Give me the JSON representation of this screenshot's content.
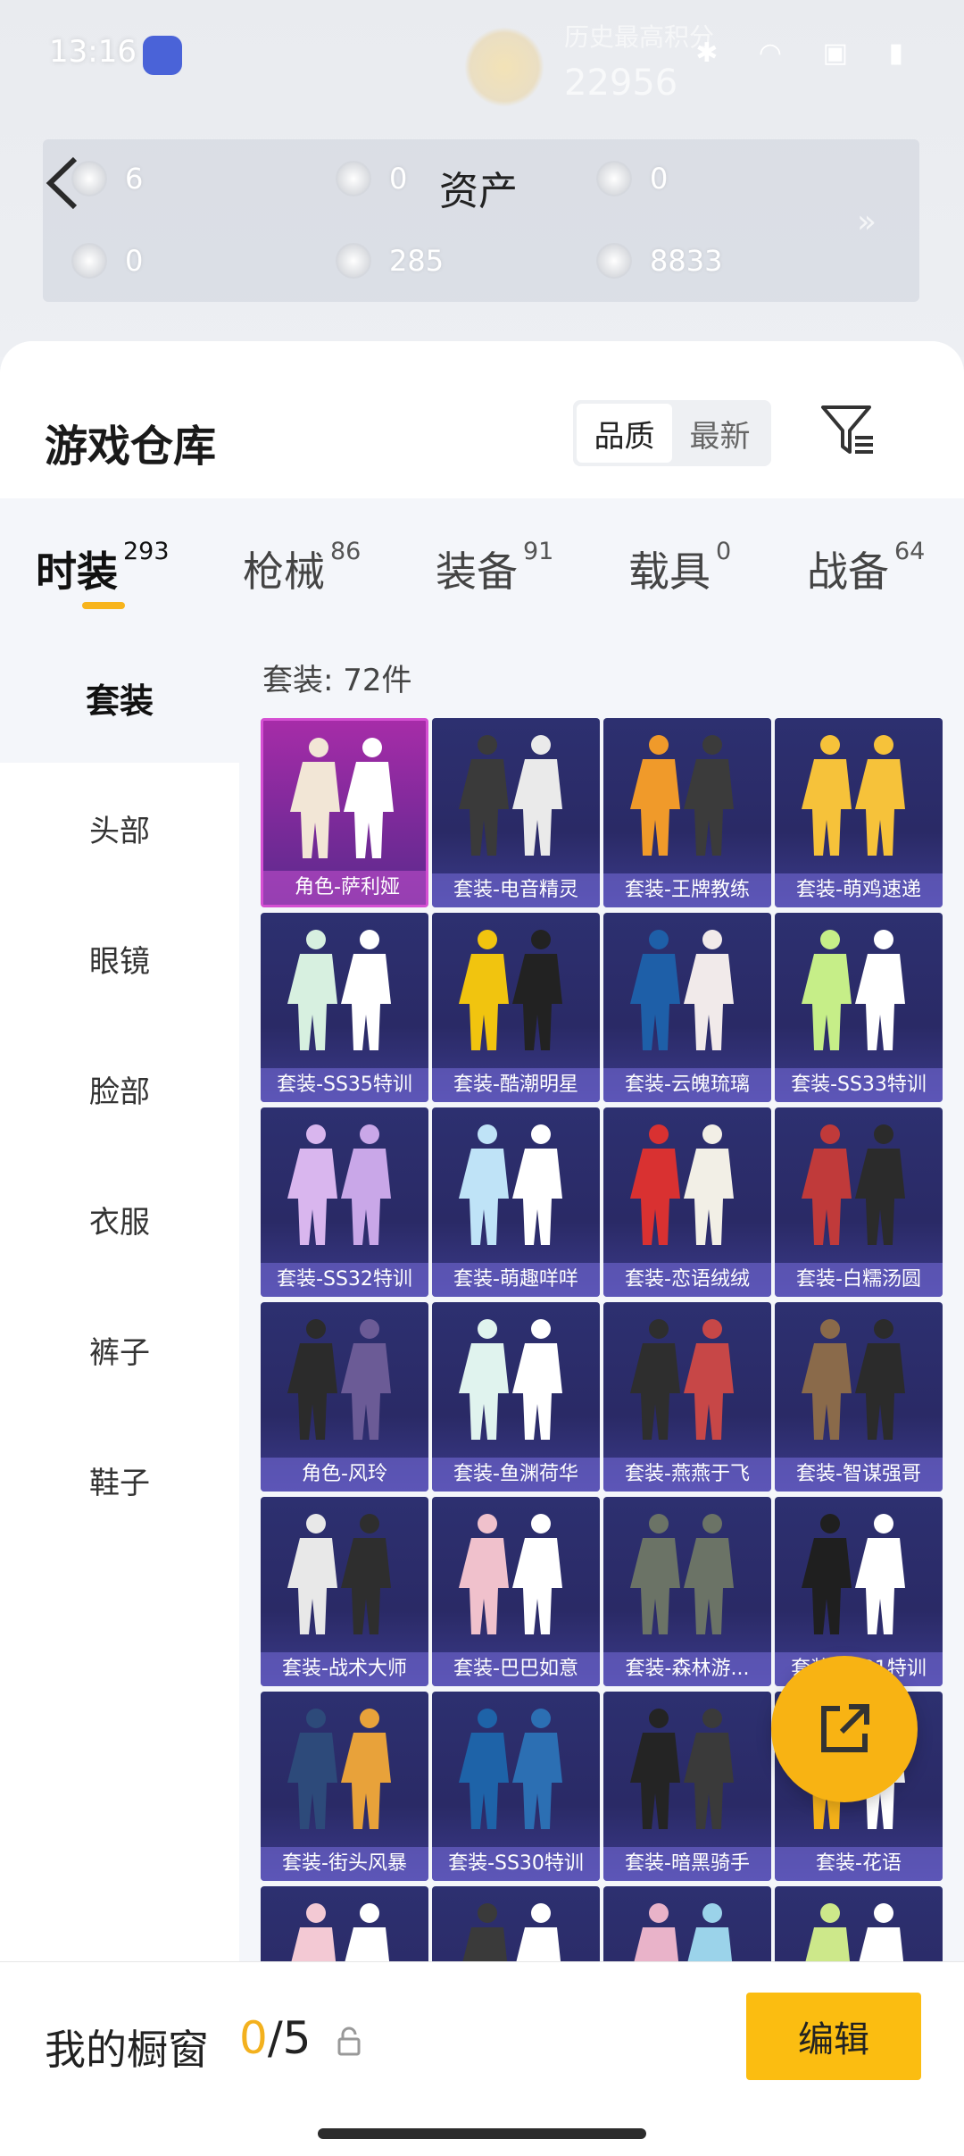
{
  "status_bar": {
    "time": "13:16"
  },
  "top_banner": {
    "label": "历史最高积分",
    "score": "22956"
  },
  "assets": {
    "title": "资产",
    "items": [
      {
        "value": "6"
      },
      {
        "value": "0"
      },
      {
        "value": "0"
      },
      {
        "value": "0"
      },
      {
        "value": "285"
      },
      {
        "value": "8833"
      }
    ]
  },
  "warehouse": {
    "title": "游戏仓库",
    "sort_options": [
      "品质",
      "最新"
    ],
    "active_sort": "品质"
  },
  "categories": [
    {
      "name": "时装",
      "count": "293"
    },
    {
      "name": "枪械",
      "count": "86"
    },
    {
      "name": "装备",
      "count": "91"
    },
    {
      "name": "载具",
      "count": "0"
    },
    {
      "name": "战备",
      "count": "64"
    }
  ],
  "accent_color": "#fbbd11",
  "side_menu": [
    "套装",
    "头部",
    "眼镜",
    "脸部",
    "衣服",
    "裤子",
    "鞋子"
  ],
  "grid": {
    "caption": "套装: 72件",
    "items": [
      {
        "label": "角色-萨利娅",
        "rarity": "purple"
      },
      {
        "label": "套装-电音精灵"
      },
      {
        "label": "套装-王牌教练"
      },
      {
        "label": "套装-萌鸡速递"
      },
      {
        "label": "套装-SS35特训"
      },
      {
        "label": "套装-酷潮明星"
      },
      {
        "label": "套装-云魄琉璃"
      },
      {
        "label": "套装-SS33特训"
      },
      {
        "label": "套装-SS32特训"
      },
      {
        "label": "套装-萌趣咩咩"
      },
      {
        "label": "套装-恋语绒绒"
      },
      {
        "label": "套装-白糯汤圆"
      },
      {
        "label": "角色-风玲"
      },
      {
        "label": "套装-鱼渊荷华"
      },
      {
        "label": "套装-燕燕于飞"
      },
      {
        "label": "套装-智谋强哥"
      },
      {
        "label": "套装-战术大师"
      },
      {
        "label": "套装-巴巴如意"
      },
      {
        "label": "套装-森林游..."
      },
      {
        "label": "套装-SS31特训"
      },
      {
        "label": "套装-街头风暴"
      },
      {
        "label": "套装-SS30特训"
      },
      {
        "label": "套装-暗黑骑手"
      },
      {
        "label": "套装-花语"
      },
      {
        "label": ""
      },
      {
        "label": ""
      },
      {
        "label": ""
      },
      {
        "label": ""
      }
    ]
  },
  "showcase": {
    "label": "我的橱窗",
    "current": "0",
    "separator": "/",
    "max": "5",
    "edit_label": "编辑"
  }
}
